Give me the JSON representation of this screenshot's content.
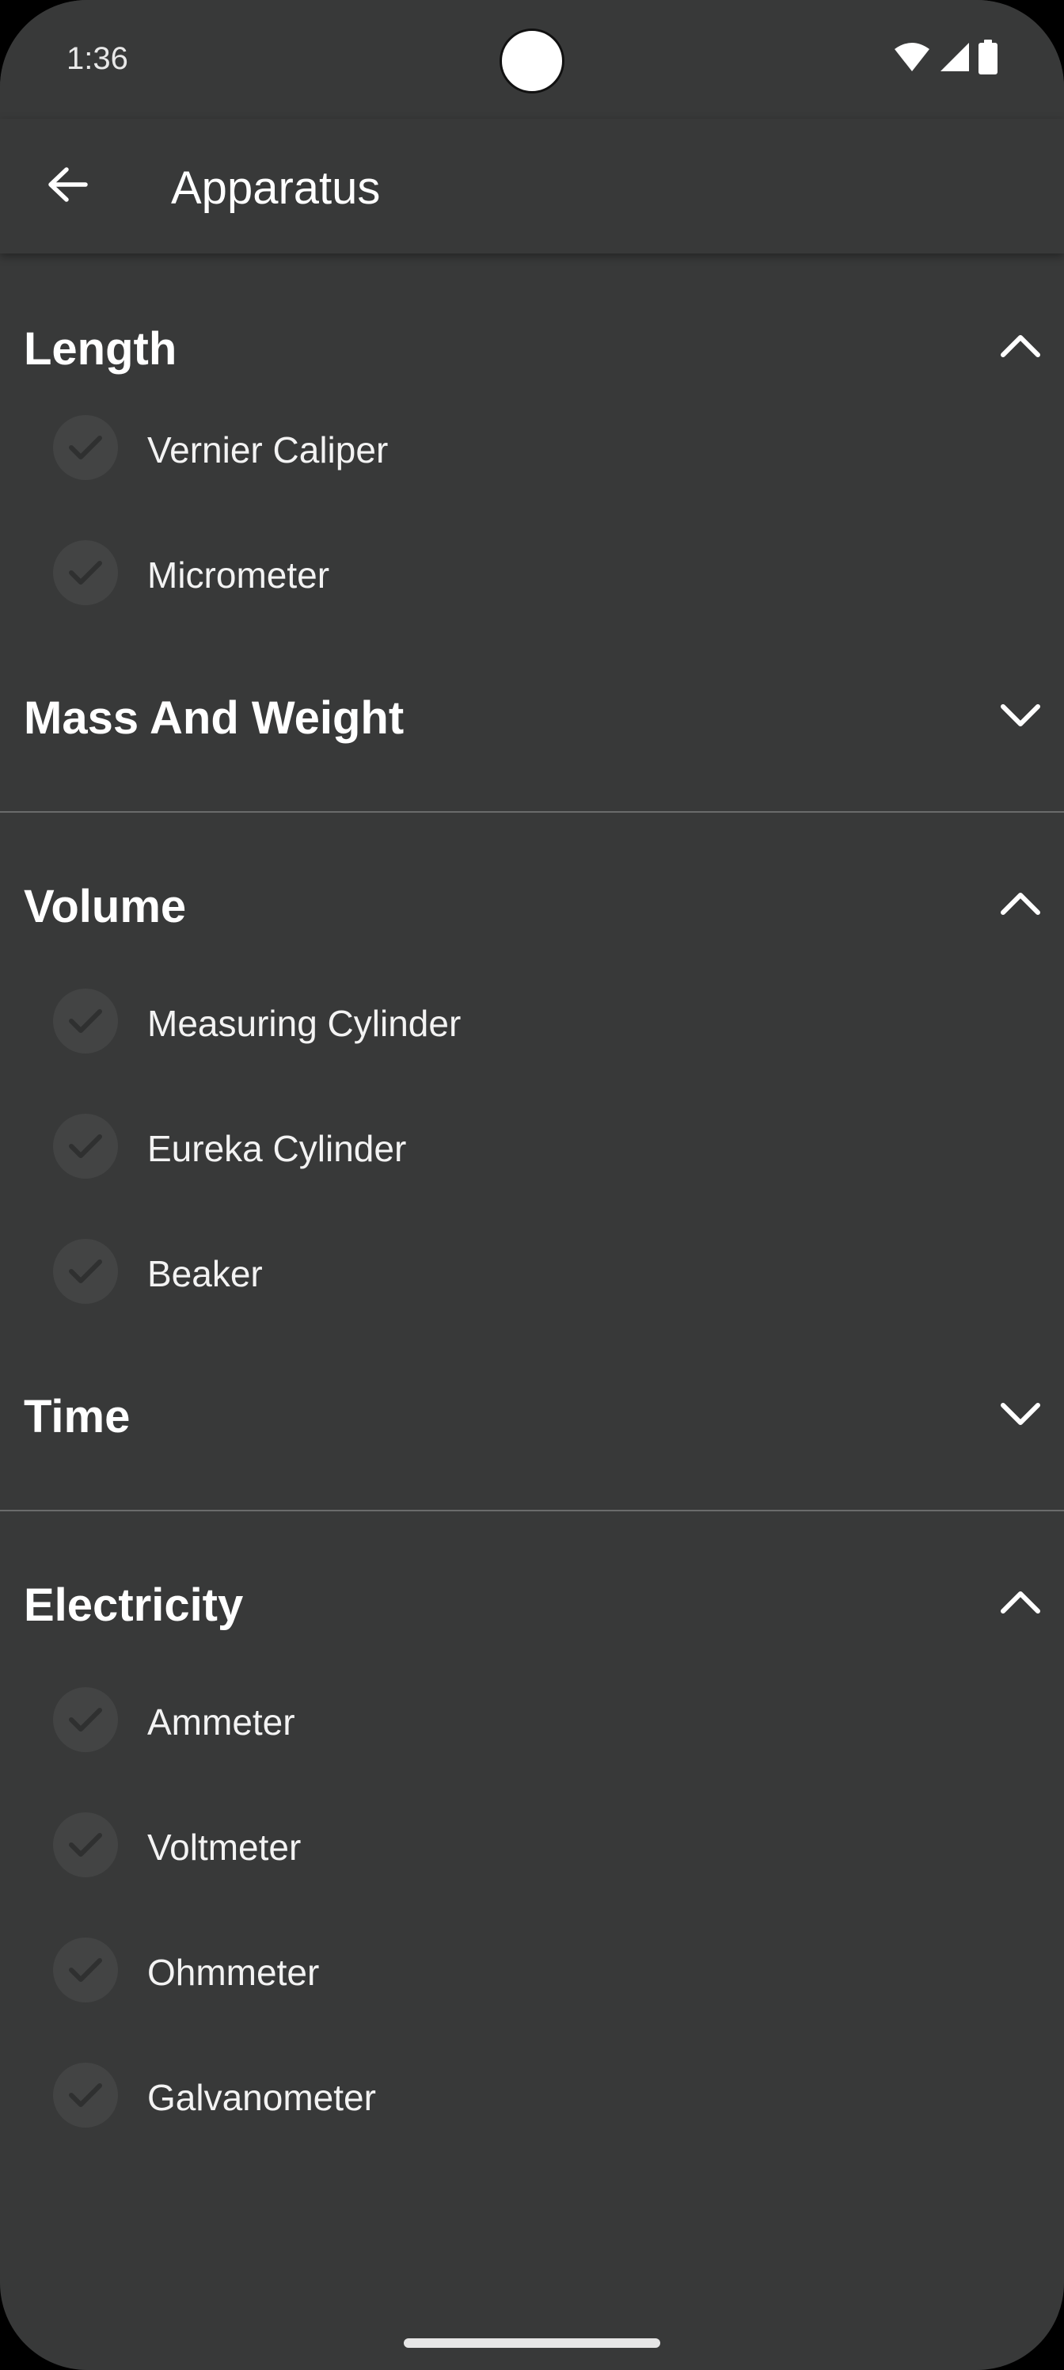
{
  "status": {
    "time": "1:36",
    "icons": [
      "wifi-icon",
      "signal-icon",
      "battery-icon"
    ]
  },
  "appbar": {
    "title": "Apparatus",
    "back_icon": "arrow-left-icon"
  },
  "sections": [
    {
      "title": "Length",
      "expanded": true,
      "chevron": "chevron-up-icon",
      "items": [
        {
          "label": "Vernier Caliper"
        },
        {
          "label": "Micrometer"
        }
      ]
    },
    {
      "title": "Mass And Weight",
      "expanded": false,
      "chevron": "chevron-down-icon",
      "items": []
    },
    {
      "title": "Volume",
      "expanded": true,
      "chevron": "chevron-up-icon",
      "items": [
        {
          "label": "Measuring Cylinder"
        },
        {
          "label": "Eureka Cylinder"
        },
        {
          "label": "Beaker"
        }
      ]
    },
    {
      "title": "Time",
      "expanded": false,
      "chevron": "chevron-down-icon",
      "items": []
    },
    {
      "title": "Electricity",
      "expanded": true,
      "chevron": "chevron-up-icon",
      "items": [
        {
          "label": "Ammeter"
        },
        {
          "label": "Voltmeter"
        },
        {
          "label": "Ohmmeter"
        },
        {
          "label": "Galvanometer"
        }
      ]
    }
  ],
  "colors": {
    "background": "#383939",
    "text": "#ffffff",
    "check_bg": "#434444",
    "check_mark": "#2f3030",
    "divider": "#6a6b6b"
  }
}
